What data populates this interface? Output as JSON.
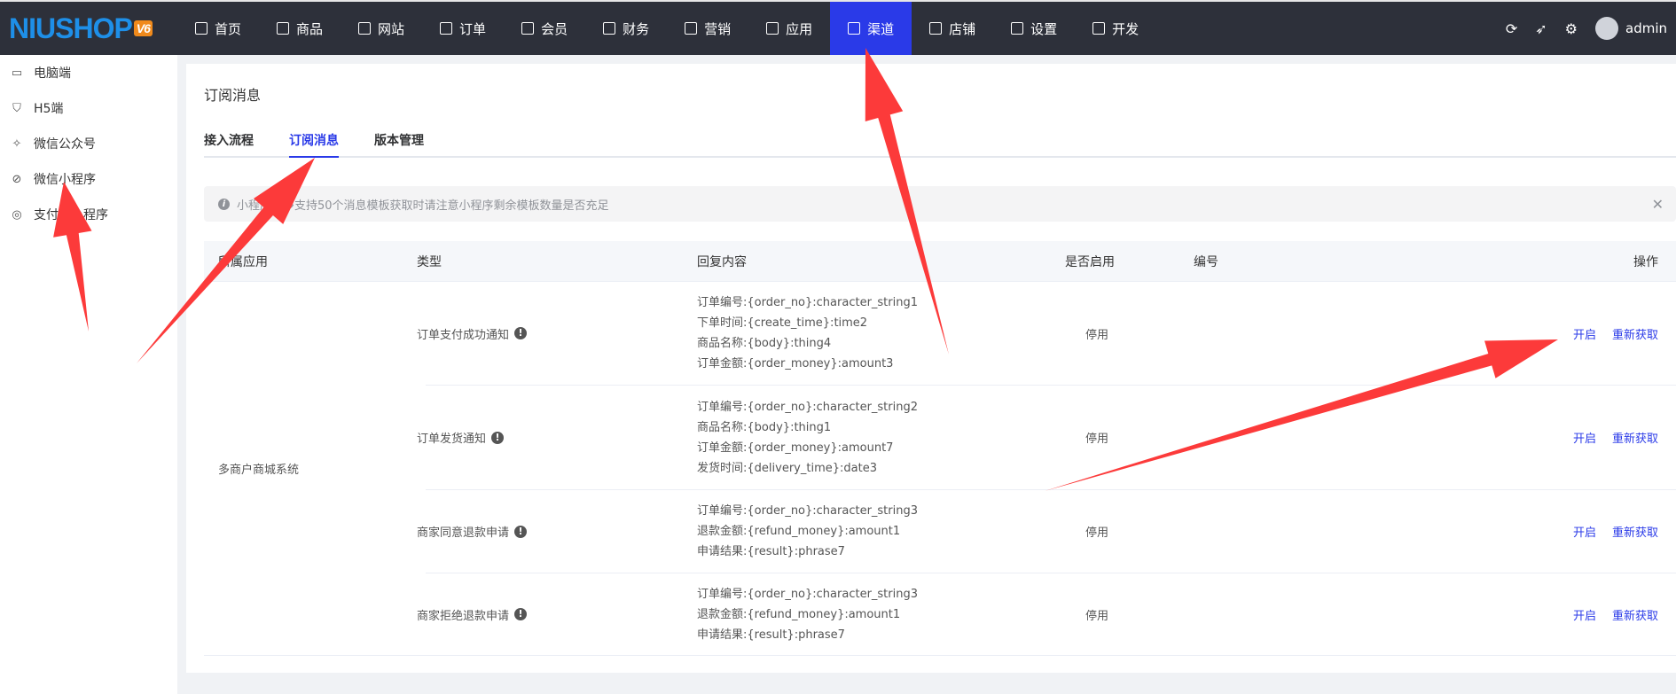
{
  "brand": {
    "logo": "NIUSHOP",
    "version": "V6"
  },
  "nav": [
    {
      "label": "首页",
      "icon": "monitor-icon"
    },
    {
      "label": "商品",
      "icon": "goods-icon"
    },
    {
      "label": "网站",
      "icon": "website-icon"
    },
    {
      "label": "订单",
      "icon": "order-icon"
    },
    {
      "label": "会员",
      "icon": "member-icon"
    },
    {
      "label": "财务",
      "icon": "finance-icon"
    },
    {
      "label": "营销",
      "icon": "marketing-icon"
    },
    {
      "label": "应用",
      "icon": "app-icon"
    },
    {
      "label": "渠道",
      "icon": "channel-icon",
      "active": true
    },
    {
      "label": "店铺",
      "icon": "shop-icon"
    },
    {
      "label": "设置",
      "icon": "gear-icon"
    },
    {
      "label": "开发",
      "icon": "code-icon"
    }
  ],
  "user": {
    "name": "admin"
  },
  "sidebar": [
    {
      "label": "电脑端",
      "glyph": "▭"
    },
    {
      "label": "H5端",
      "glyph": "⛉"
    },
    {
      "label": "微信公众号",
      "glyph": "✧"
    },
    {
      "label": "微信小程序",
      "glyph": "⊘"
    },
    {
      "label": "支付宝小程序",
      "glyph": "◎"
    }
  ],
  "page": {
    "title": "订阅消息",
    "tabs": [
      "接入流程",
      "订阅消息",
      "版本管理"
    ],
    "active_tab": 1,
    "alert": "小程序最多支持50个消息模板获取时请注意小程序剩余模板数量是否充足",
    "alert_close": "✕"
  },
  "table": {
    "headers": {
      "app": "所属应用",
      "type": "类型",
      "content": "回复内容",
      "enabled": "是否启用",
      "code": "编号",
      "action": "操作"
    },
    "app_name": "多商户商城系统",
    "rows": [
      {
        "type": "订单支付成功通知",
        "content": [
          "订单编号:{order_no}:character_string1",
          "下单时间:{create_time}:time2",
          "商品名称:{body}:thing4",
          "订单金额:{order_money}:amount3"
        ],
        "status": "停用",
        "actions": [
          "开启",
          "重新获取"
        ]
      },
      {
        "type": "订单发货通知",
        "content": [
          "订单编号:{order_no}:character_string2",
          "商品名称:{body}:thing1",
          "订单金额:{order_money}:amount7",
          "发货时间:{delivery_time}:date3"
        ],
        "status": "停用",
        "actions": [
          "开启",
          "重新获取"
        ]
      },
      {
        "type": "商家同意退款申请",
        "content": [
          "订单编号:{order_no}:character_string3",
          "退款金额:{refund_money}:amount1",
          "申请结果:{result}:phrase7"
        ],
        "status": "停用",
        "actions": [
          "开启",
          "重新获取"
        ]
      },
      {
        "type": "商家拒绝退款申请",
        "content": [
          "订单编号:{order_no}:character_string3",
          "退款金额:{refund_money}:amount1",
          "申请结果:{result}:phrase7"
        ],
        "status": "停用",
        "actions": [
          "开启",
          "重新获取"
        ]
      }
    ]
  },
  "annotation_color": "#fc3a3a"
}
